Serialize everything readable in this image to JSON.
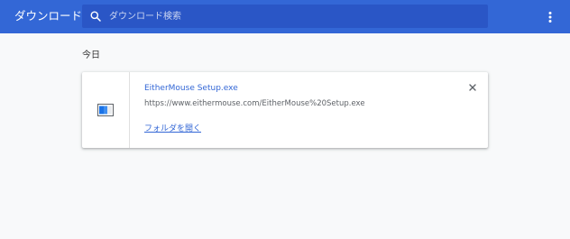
{
  "header": {
    "title": "ダウンロード",
    "search_placeholder": "ダウンロード検索",
    "search_value": ""
  },
  "section": {
    "date_header": "今日"
  },
  "downloads": [
    {
      "file_name": "EitherMouse Setup.exe",
      "url": "https://www.eithermouse.com/EitherMouse%20Setup.exe",
      "action_label": "フォルダを開く",
      "icon": "exe-file-icon"
    }
  ],
  "icons": {
    "search": "search-icon",
    "more": "more-vert-icon",
    "remove": "close-icon"
  },
  "colors": {
    "toolbar": "#3367d6",
    "search_bg": "#2a56c6",
    "link": "#3367d6",
    "page_bg": "#f8f9fa"
  }
}
